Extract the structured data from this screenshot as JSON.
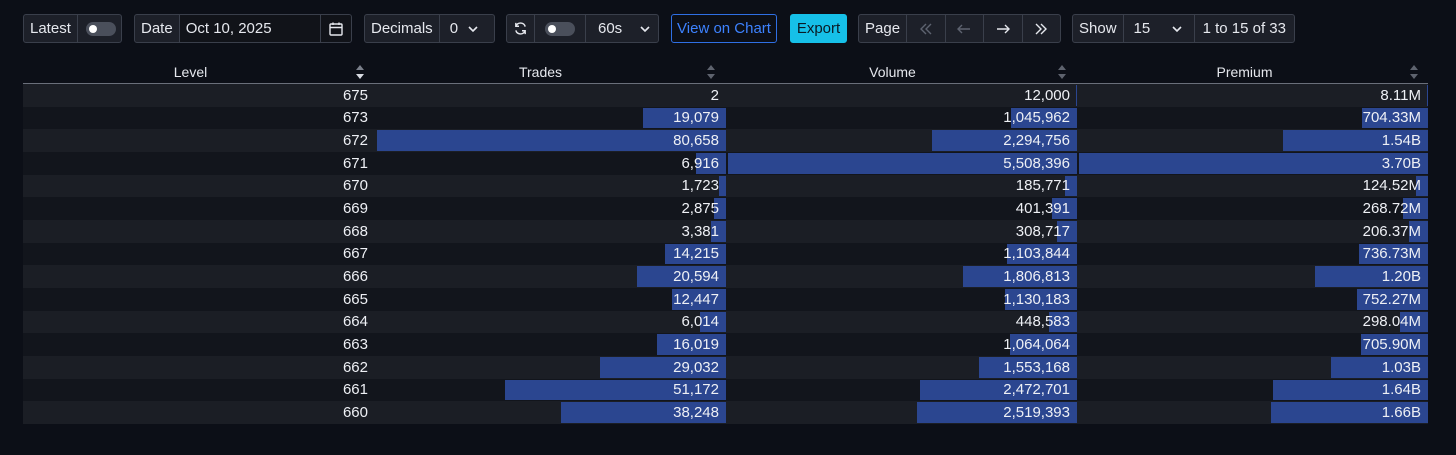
{
  "toolbar": {
    "latest_label": "Latest",
    "date_label": "Date",
    "date_value": "Oct 10, 2025",
    "decimals_label": "Decimals",
    "decimals_value": "0",
    "refresh_interval": "60s",
    "view_on_chart_label": "View on Chart",
    "export_label": "Export",
    "page_label": "Page",
    "show_label": "Show",
    "show_value": "15",
    "range_text": "1 to 15 of 33"
  },
  "colors": {
    "background": "#0c0f17",
    "bar": "#2b4690",
    "export_button": "#16c0e8",
    "view_chart_button": "#2f6fe4"
  },
  "table": {
    "columns": [
      "Level",
      "Trades",
      "Volume",
      "Premium"
    ],
    "max": {
      "trades": 80658,
      "volume": 5508396,
      "premium": 3.7
    },
    "rows": [
      {
        "level": "675",
        "trades": "2",
        "trades_n": 2,
        "volume": "12,000",
        "volume_n": 12000,
        "premium": "8.11M",
        "premium_n": 0.00811
      },
      {
        "level": "673",
        "trades": "19,079",
        "trades_n": 19079,
        "volume": "1,045,962",
        "volume_n": 1045962,
        "premium": "704.33M",
        "premium_n": 0.70433
      },
      {
        "level": "672",
        "trades": "80,658",
        "trades_n": 80658,
        "volume": "2,294,756",
        "volume_n": 2294756,
        "premium": "1.54B",
        "premium_n": 1.54
      },
      {
        "level": "671",
        "trades": "6,916",
        "trades_n": 6916,
        "volume": "5,508,396",
        "volume_n": 5508396,
        "premium": "3.70B",
        "premium_n": 3.7
      },
      {
        "level": "670",
        "trades": "1,723",
        "trades_n": 1723,
        "volume": "185,771",
        "volume_n": 185771,
        "premium": "124.52M",
        "premium_n": 0.12452
      },
      {
        "level": "669",
        "trades": "2,875",
        "trades_n": 2875,
        "volume": "401,391",
        "volume_n": 401391,
        "premium": "268.72M",
        "premium_n": 0.26872
      },
      {
        "level": "668",
        "trades": "3,381",
        "trades_n": 3381,
        "volume": "308,717",
        "volume_n": 308717,
        "premium": "206.37M",
        "premium_n": 0.20637
      },
      {
        "level": "667",
        "trades": "14,215",
        "trades_n": 14215,
        "volume": "1,103,844",
        "volume_n": 1103844,
        "premium": "736.73M",
        "premium_n": 0.73673
      },
      {
        "level": "666",
        "trades": "20,594",
        "trades_n": 20594,
        "volume": "1,806,813",
        "volume_n": 1806813,
        "premium": "1.20B",
        "premium_n": 1.2
      },
      {
        "level": "665",
        "trades": "12,447",
        "trades_n": 12447,
        "volume": "1,130,183",
        "volume_n": 1130183,
        "premium": "752.27M",
        "premium_n": 0.75227
      },
      {
        "level": "664",
        "trades": "6,014",
        "trades_n": 6014,
        "volume": "448,583",
        "volume_n": 448583,
        "premium": "298.04M",
        "premium_n": 0.29804
      },
      {
        "level": "663",
        "trades": "16,019",
        "trades_n": 16019,
        "volume": "1,064,064",
        "volume_n": 1064064,
        "premium": "705.90M",
        "premium_n": 0.7059
      },
      {
        "level": "662",
        "trades": "29,032",
        "trades_n": 29032,
        "volume": "1,553,168",
        "volume_n": 1553168,
        "premium": "1.03B",
        "premium_n": 1.03
      },
      {
        "level": "661",
        "trades": "51,172",
        "trades_n": 51172,
        "volume": "2,472,701",
        "volume_n": 2472701,
        "premium": "1.64B",
        "premium_n": 1.64
      },
      {
        "level": "660",
        "trades": "38,248",
        "trades_n": 38248,
        "volume": "2,519,393",
        "volume_n": 2519393,
        "premium": "1.66B",
        "premium_n": 1.66
      }
    ]
  }
}
